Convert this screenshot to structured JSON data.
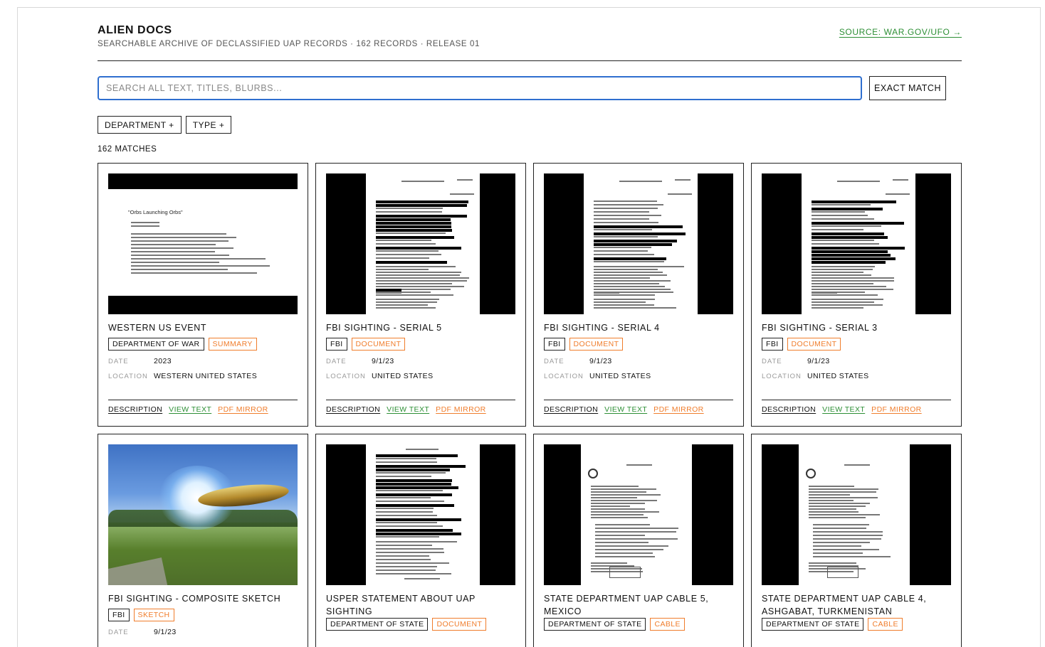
{
  "header": {
    "title": "ALIEN DOCS",
    "subtitle": "SEARCHABLE ARCHIVE OF DECLASSIFIED UAP RECORDS · 162 RECORDS · RELEASE 01",
    "source_link": "SOURCE: WAR.GOV/UFO →"
  },
  "search": {
    "placeholder": "SEARCH ALL TEXT, TITLES, BLURBS...",
    "value": "",
    "exact_match_label": "EXACT MATCH"
  },
  "filters": {
    "department_label": "DEPARTMENT +",
    "type_label": "TYPE +"
  },
  "results": {
    "count_label": "162 MATCHES"
  },
  "labels": {
    "date": "DATE",
    "location": "LOCATION",
    "description": "DESCRIPTION",
    "view_text": "VIEW TEXT",
    "pdf_mirror": "PDF MIRROR"
  },
  "colors": {
    "accent_green": "#2d8f35",
    "accent_orange": "#f07d2c",
    "focus_blue": "#2f6fcf"
  },
  "cards": [
    {
      "title": "WESTERN US EVENT",
      "department": "DEPARTMENT OF WAR",
      "type": "SUMMARY",
      "date": "2023",
      "location": "WESTERN UNITED STATES",
      "thumbnail": "slide",
      "thumbnail_title": "\"Orbs Launching Orbs\""
    },
    {
      "title": "FBI SIGHTING - SERIAL 5",
      "department": "FBI",
      "type": "DOCUMENT",
      "date": "9/1/23",
      "location": "UNITED STATES",
      "thumbnail": "redacted-document"
    },
    {
      "title": "FBI SIGHTING - SERIAL 4",
      "department": "FBI",
      "type": "DOCUMENT",
      "date": "9/1/23",
      "location": "UNITED STATES",
      "thumbnail": "redacted-document"
    },
    {
      "title": "FBI SIGHTING - SERIAL 3",
      "department": "FBI",
      "type": "DOCUMENT",
      "date": "9/1/23",
      "location": "UNITED STATES",
      "thumbnail": "redacted-document"
    },
    {
      "title": "FBI SIGHTING - COMPOSITE SKETCH",
      "department": "FBI",
      "type": "SKETCH",
      "date": "9/1/23",
      "thumbnail": "ufo-sketch"
    },
    {
      "title": "USPER STATEMENT ABOUT UAP SIGHTING",
      "department": "DEPARTMENT OF STATE",
      "type": "DOCUMENT",
      "thumbnail": "redacted-statement"
    },
    {
      "title": "STATE DEPARTMENT UAP CABLE 5, MEXICO",
      "department": "DEPARTMENT OF STATE",
      "type": "CABLE",
      "thumbnail": "cable-document"
    },
    {
      "title": "STATE DEPARTMENT UAP CABLE 4, ASHGABAT, TURKMENISTAN",
      "department": "DEPARTMENT OF STATE",
      "type": "CABLE",
      "thumbnail": "cable-document"
    }
  ]
}
